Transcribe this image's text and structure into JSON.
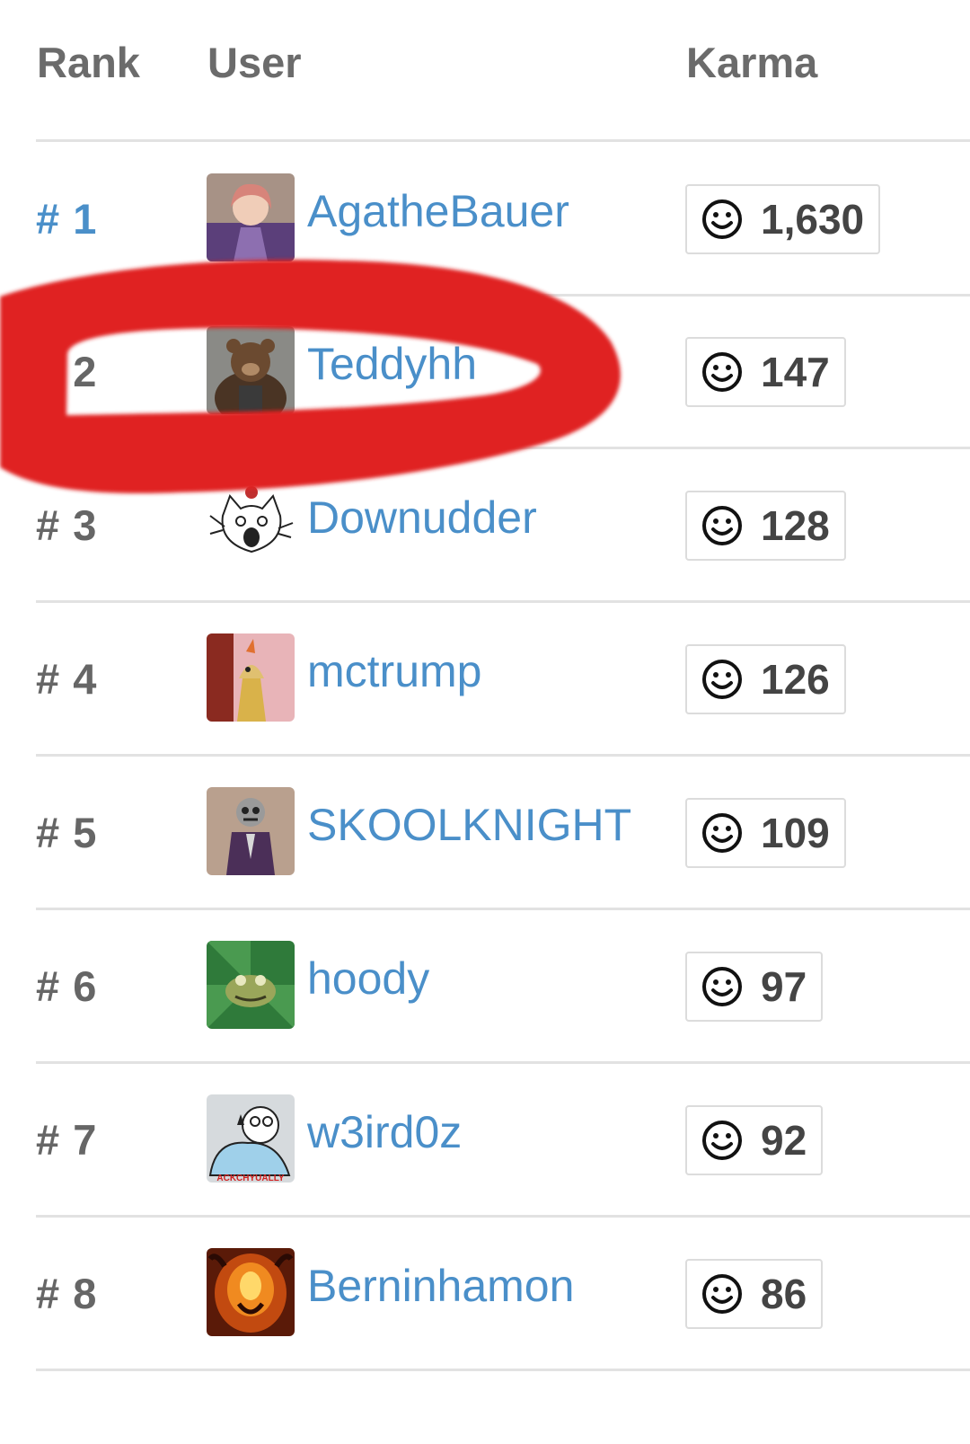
{
  "table": {
    "headers": {
      "rank": "Rank",
      "user": "User",
      "karma": "Karma"
    },
    "rows": [
      {
        "rank": "# 1",
        "user": "AgatheBauer",
        "karma": "1,630"
      },
      {
        "rank": "# 2",
        "user": "Teddyhh",
        "karma": "147"
      },
      {
        "rank": "# 3",
        "user": "Downudder",
        "karma": "128"
      },
      {
        "rank": "# 4",
        "user": "mctrump",
        "karma": "126"
      },
      {
        "rank": "# 5",
        "user": "SKOOLKNIGHT",
        "karma": "109"
      },
      {
        "rank": "# 6",
        "user": "hoody",
        "karma": "97"
      },
      {
        "rank": "# 7",
        "user": "w3ird0z",
        "karma": "92"
      },
      {
        "rank": "# 8",
        "user": "Berninhamon",
        "karma": "86"
      }
    ]
  },
  "avatars": {
    "row7_caption": "ACKCHYUALLY"
  },
  "icons": {
    "karma": "smiley-face-icon"
  },
  "colors": {
    "link": "#4a8fc9",
    "rank_text": "#666666",
    "divider": "#e2e2e2",
    "annotation": "#e02020"
  }
}
